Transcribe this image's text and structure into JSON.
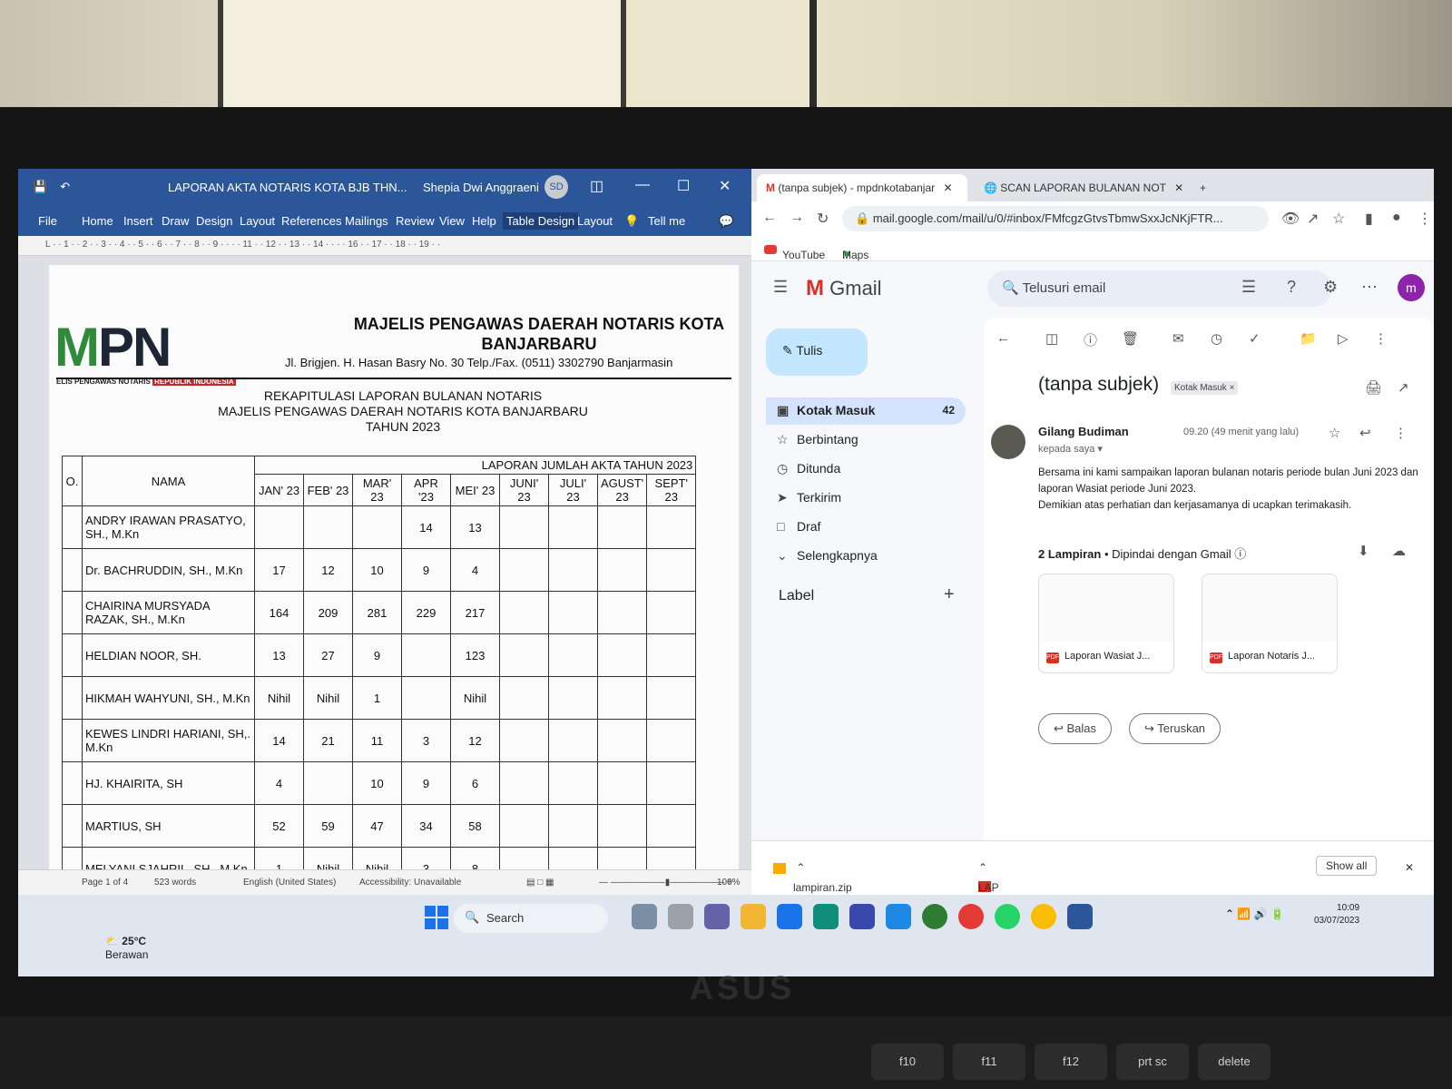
{
  "word": {
    "doc_title": "LAPORAN AKTA NOTARIS KOTA BJB THN...",
    "user": "Shepia Dwi Anggraeni",
    "user_initials": "SD",
    "menu": [
      "File",
      "Home",
      "Insert",
      "Draw",
      "Design",
      "Layout",
      "References",
      "Mailings",
      "Review",
      "View",
      "Help",
      "Table Design",
      "Layout"
    ],
    "tell_me": "Tell me",
    "ruler": "L · · 1 · · 2 · · 3 · · 4 · · 5 · · 6 · · 7 · · 8 · · 9 · · · · 11 · · 12 · · 13 · · 14 · · · · 16 · · 17 · · 18 · · 19 · ·",
    "logo_text": "MPN",
    "logo_sub": "ELIS PENGAWAS NOTARIS",
    "logo_sub2": "REPUBLIK INDONESIA",
    "header_title": "MAJELIS PENGAWAS DAERAH NOTARIS KOTA BANJARBARU",
    "header_address": "Jl. Brigjen. H. Hasan Basry No. 30 Telp./Fax. (0511) 3302790 Banjarmasin",
    "rekap": [
      "REKAPITULASI LAPORAN BULANAN NOTARIS",
      "MAJELIS PENGAWAS DAERAH NOTARIS KOTA BANJARBARU",
      "TAHUN 2023"
    ],
    "table": {
      "group_header": "LAPORAN JUMLAH AKTA TAHUN 2023",
      "no_header": "O.",
      "name_header": "NAMA",
      "months": [
        "JAN' 23",
        "FEB' 23",
        "MAR' 23",
        "APR '23",
        "MEI' 23",
        "JUNI' 23",
        "JULI' 23",
        "AGUST' 23",
        "SEPT' 23"
      ],
      "rows": [
        {
          "name": "ANDRY IRAWAN PRASATYO, SH., M.Kn",
          "values": [
            "",
            "",
            "",
            "14",
            "13",
            "",
            "",
            "",
            ""
          ]
        },
        {
          "name": "Dr. BACHRUDDIN, SH., M.Kn",
          "values": [
            "17",
            "12",
            "10",
            "9",
            "4",
            "",
            "",
            "",
            ""
          ]
        },
        {
          "name": "CHAIRINA MURSYADA RAZAK, SH., M.Kn",
          "values": [
            "164",
            "209",
            "281",
            "229",
            "217",
            "",
            "",
            "",
            ""
          ]
        },
        {
          "name": "HELDIAN NOOR, SH.",
          "values": [
            "13",
            "27",
            "9",
            "",
            "123",
            "",
            "",
            "",
            ""
          ]
        },
        {
          "name": "HIKMAH WAHYUNI, SH., M.Kn",
          "values": [
            "Nihil",
            "Nihil",
            "1",
            "",
            "Nihil",
            "",
            "",
            "",
            ""
          ]
        },
        {
          "name": "KEWES LINDRI HARIANI, SH,. M.Kn",
          "values": [
            "14",
            "21",
            "11",
            "3",
            "12",
            "",
            "",
            "",
            ""
          ]
        },
        {
          "name": "HJ. KHAIRITA, SH",
          "values": [
            "4",
            "",
            "10",
            "9",
            "6",
            "",
            "",
            "",
            ""
          ]
        },
        {
          "name": "MARTIUS, SH",
          "values": [
            "52",
            "59",
            "47",
            "34",
            "58",
            "",
            "",
            "",
            ""
          ]
        },
        {
          "name": "MELYANI SJAHRIL, SH., M.Kn",
          "values": [
            "1",
            "Nihil",
            "Nihil",
            "3",
            "8",
            "",
            "",
            "",
            ""
          ]
        }
      ]
    },
    "status": {
      "page": "Page 1 of 4",
      "words": "523 words",
      "lang": "English (United States)",
      "accessibility": "Accessibility: Unavailable",
      "zoom": "100%"
    }
  },
  "chrome": {
    "tabs": [
      "(tanpa subjek) - mpdnkotabanjar",
      "SCAN LAPORAN BULANAN NOT"
    ],
    "url": "mail.google.com/mail/u/0/#inbox/FMfcgzGtvsTbmwSxxJcNKjFTR...",
    "bookmarks": [
      "YouTube",
      "Maps"
    ]
  },
  "gmail": {
    "brand": "Gmail",
    "search_placeholder": "Telusuri email",
    "avatar": "m",
    "compose": "Tulis",
    "nav": [
      {
        "label": "Kotak Masuk",
        "count": "42"
      },
      {
        "label": "Berbintang",
        "count": ""
      },
      {
        "label": "Ditunda",
        "count": ""
      },
      {
        "label": "Terkirim",
        "count": ""
      },
      {
        "label": "Draf",
        "count": ""
      },
      {
        "label": "Selengkapnya",
        "count": ""
      }
    ],
    "label_heading": "Label",
    "subject": "(tanpa subjek)",
    "inbox_badge": "Kotak Masuk ×",
    "sender": "Gilang Budiman",
    "to": "kepada saya ▾",
    "time": "09.20 (49 menit yang lalu)",
    "body": [
      "Bersama ini kami sampaikan laporan bulanan notaris periode bulan Juni 2023 dan laporan Wasiat periode Juni 2023.",
      "Demikian atas perhatian dan kerjasamanya di ucapkan terimakasih."
    ],
    "attach_count": "2 Lampiran",
    "attach_scan": "Dipindai dengan Gmail",
    "attachments": [
      "Laporan Wasiat J...",
      "Laporan Notaris J..."
    ],
    "reply": "Balas",
    "forward": "Teruskan",
    "downloads": [
      "lampiran.zip",
      "LAP BULANAN NO....pdf"
    ],
    "show_all": "Show all"
  },
  "taskbar": {
    "weather_temp": "25°C",
    "weather_desc": "Berawan",
    "search": "Search",
    "time": "10:09",
    "date": "03/07/2023"
  },
  "keyboard": [
    "f10",
    "f11",
    "f12",
    "prt sc",
    "delete"
  ],
  "laptop_brand": "ASUS"
}
